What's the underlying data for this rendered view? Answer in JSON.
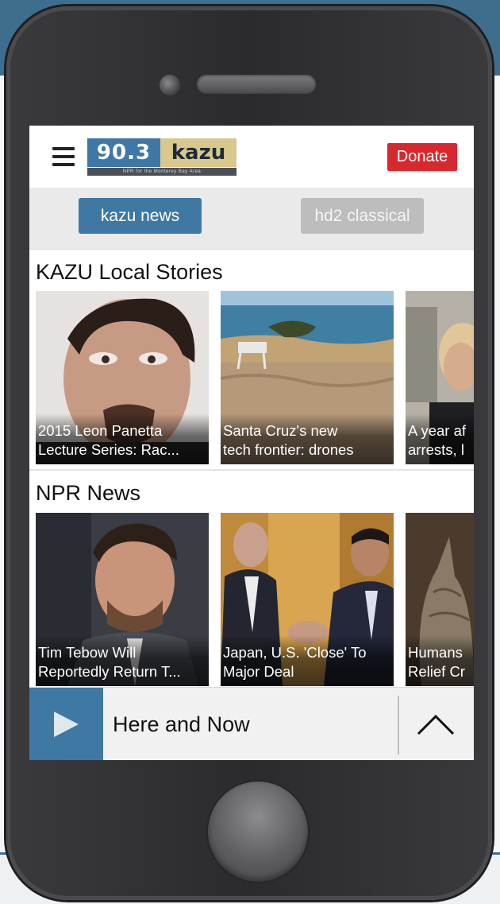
{
  "header": {
    "logo_number": "90.3",
    "logo_word": "kazu",
    "logo_tagline": "NPR for the Monterey Bay Area",
    "donate_label": "Donate"
  },
  "streams": [
    {
      "label": "kazu news",
      "active": true
    },
    {
      "label": "hd2 classical",
      "active": false
    }
  ],
  "sections": [
    {
      "title": "KAZU Local Stories",
      "cards": [
        {
          "line1": "2015 Leon Panetta",
          "line2": "Lecture Series: Rac..."
        },
        {
          "line1": "Santa Cruz's new",
          "line2": "tech frontier: drones"
        },
        {
          "line1": "A year af",
          "line2": "arrests, l"
        }
      ]
    },
    {
      "title": "NPR News",
      "cards": [
        {
          "line1": "Tim Tebow Will",
          "line2": "Reportedly Return T..."
        },
        {
          "line1": "Japan, U.S. 'Close' To",
          "line2": "Major Deal"
        },
        {
          "line1": "Humans",
          "line2": "Relief Cr"
        }
      ]
    }
  ],
  "player": {
    "now_playing": "Here and Now"
  },
  "icons": {
    "menu": "hamburger-icon",
    "play": "play-icon",
    "expand": "chevron-up-icon"
  },
  "colors": {
    "brand_blue": "#3e78a3",
    "donate_red": "#d8282e",
    "logo_gold": "#d9c88e"
  }
}
